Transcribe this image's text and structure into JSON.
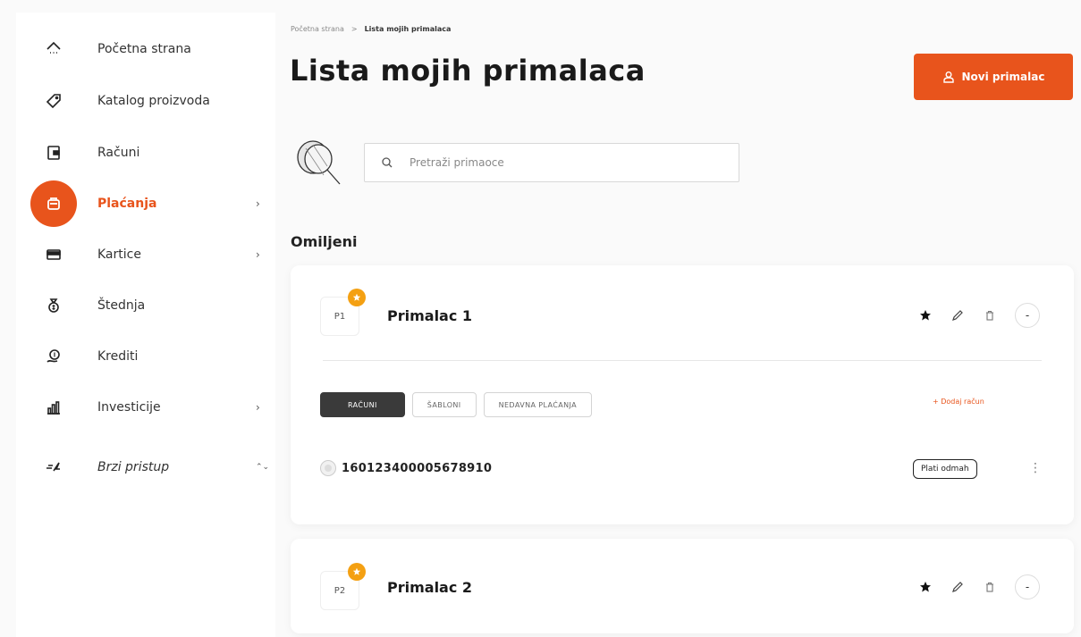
{
  "sidebar": {
    "items": [
      {
        "label": "Početna strana",
        "icon": "home-icon",
        "chevron": ""
      },
      {
        "label": "Katalog proizvoda",
        "icon": "tag-icon",
        "chevron": ""
      },
      {
        "label": "Računi",
        "icon": "wallet-icon",
        "chevron": ""
      },
      {
        "label": "Plaćanja",
        "icon": "payments-icon",
        "chevron": "›",
        "active": true
      },
      {
        "label": "Kartice",
        "icon": "card-icon",
        "chevron": "›"
      },
      {
        "label": "Štednja",
        "icon": "savings-icon",
        "chevron": ""
      },
      {
        "label": "Krediti",
        "icon": "loan-icon",
        "chevron": ""
      },
      {
        "label": "Investicije",
        "icon": "investments-icon",
        "chevron": "›"
      },
      {
        "label": "Brzi pristup",
        "icon": "quick-access-icon",
        "chevron": "⌃⌄"
      }
    ]
  },
  "breadcrumb": {
    "home": "Početna strana",
    "separator": ">",
    "current": "Lista mojih primalaca"
  },
  "page": {
    "title": "Lista mojih primalaca",
    "new_button": "Novi primalac"
  },
  "search": {
    "placeholder": "Pretraži primaoce"
  },
  "favorites": {
    "title": "Omiljeni",
    "recipients": [
      {
        "initials": "P1",
        "name": "Primalac 1",
        "tabs": [
          "RAČUNI",
          "ŠABLONI",
          "NEDAVNA PLAĆANJA"
        ],
        "add_account": "+ Dodaj račun",
        "account_number": "160123400005678910",
        "pay_button": "Plati odmah",
        "collapse_symbol": "-"
      },
      {
        "initials": "P2",
        "name": "Primalac 2",
        "collapse_symbol": "-"
      }
    ]
  },
  "colors": {
    "accent": "#e8541c",
    "favorite_badge": "#f4a012",
    "active_tab": "#3a3a3a"
  }
}
